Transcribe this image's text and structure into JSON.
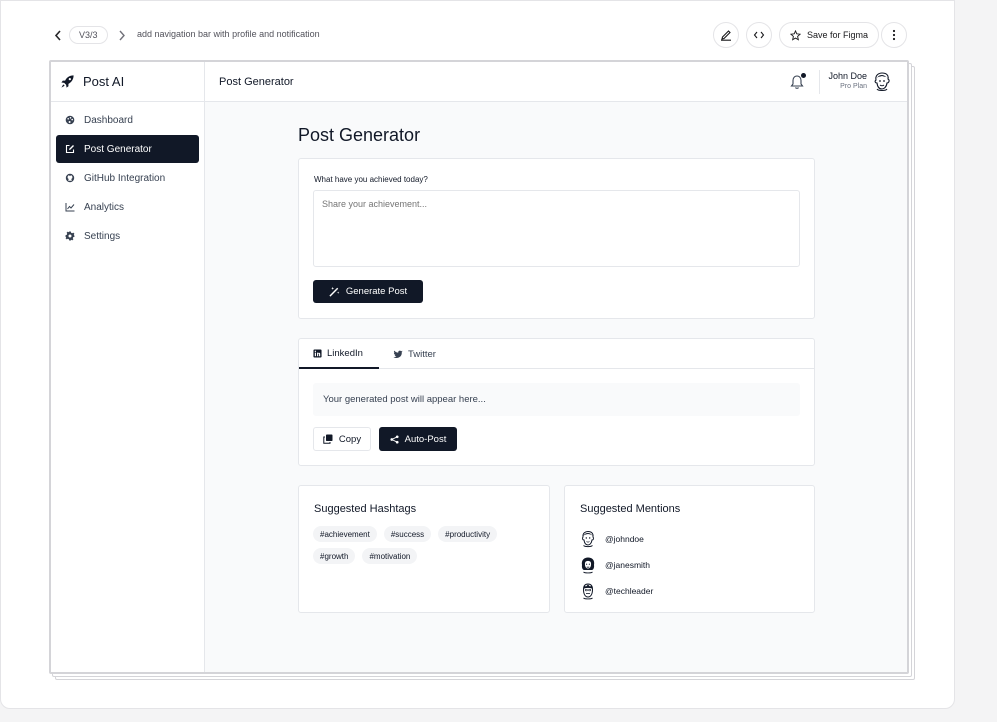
{
  "toolbar": {
    "version": "V3/3",
    "description": "add navigation bar with profile and notification",
    "save_figma": "Save for Figma"
  },
  "app": {
    "brand": "Post AI",
    "nav": [
      {
        "label": "Dashboard",
        "icon": "palette-icon"
      },
      {
        "label": "Post Generator",
        "icon": "edit-icon",
        "active": true
      },
      {
        "label": "GitHub Integration",
        "icon": "github-icon"
      },
      {
        "label": "Analytics",
        "icon": "chart-line-icon"
      },
      {
        "label": "Settings",
        "icon": "gear-icon"
      }
    ],
    "header": {
      "title": "Post Generator",
      "user_name": "John Doe",
      "user_plan": "Pro Plan"
    },
    "page_title": "Post Generator",
    "composer": {
      "label": "What have you achieved today?",
      "placeholder": "Share your achievement...",
      "generate": "Generate Post"
    },
    "preview": {
      "tabs": [
        "LinkedIn",
        "Twitter"
      ],
      "placeholder": "Your generated post will appear here...",
      "copy": "Copy",
      "auto_post": "Auto-Post"
    },
    "hashtags": {
      "title": "Suggested Hashtags",
      "items": [
        "#achievement",
        "#success",
        "#productivity",
        "#growth",
        "#motivation"
      ]
    },
    "mentions": {
      "title": "Suggested Mentions",
      "items": [
        "@johndoe",
        "@janesmith",
        "@techleader"
      ]
    }
  },
  "colors": {
    "primary": "#111827",
    "border": "#e5e7eb",
    "background": "#f9fafb"
  }
}
